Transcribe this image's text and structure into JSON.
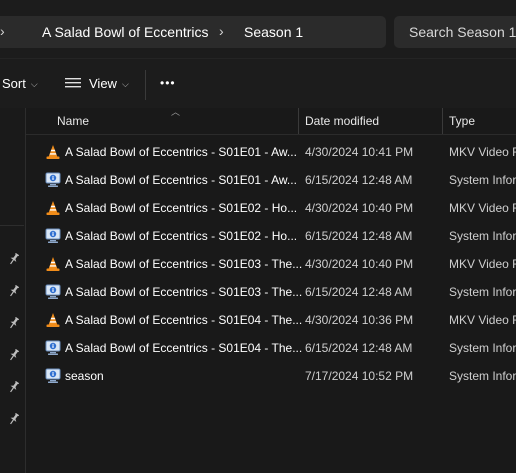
{
  "address_bar": {
    "breadcrumbs": [
      "A Salad Bowl of Eccentrics",
      "Season 1"
    ]
  },
  "search": {
    "placeholder": "Search Season 1"
  },
  "toolbar": {
    "sort_label": "Sort",
    "view_label": "View",
    "more_label": "•••"
  },
  "columns": {
    "name": "Name",
    "date": "Date modified",
    "type": "Type"
  },
  "files": [
    {
      "name": "A Salad Bowl of Eccentrics - S01E01 - Aw...",
      "date": "4/30/2024 10:41 PM",
      "type": "MKV Video F",
      "icon": "vlc-cone-icon"
    },
    {
      "name": "A Salad Bowl of Eccentrics - S01E01 - Aw...",
      "date": "6/15/2024 12:48 AM",
      "type": "System Infor",
      "icon": "system-info-icon"
    },
    {
      "name": "A Salad Bowl of Eccentrics - S01E02 - Ho...",
      "date": "4/30/2024 10:40 PM",
      "type": "MKV Video F",
      "icon": "vlc-cone-icon"
    },
    {
      "name": "A Salad Bowl of Eccentrics - S01E02 - Ho...",
      "date": "6/15/2024 12:48 AM",
      "type": "System Infor",
      "icon": "system-info-icon"
    },
    {
      "name": "A Salad Bowl of Eccentrics - S01E03 - The...",
      "date": "4/30/2024 10:40 PM",
      "type": "MKV Video F",
      "icon": "vlc-cone-icon"
    },
    {
      "name": "A Salad Bowl of Eccentrics - S01E03 - The...",
      "date": "6/15/2024 12:48 AM",
      "type": "System Infor",
      "icon": "system-info-icon"
    },
    {
      "name": "A Salad Bowl of Eccentrics - S01E04 - The...",
      "date": "4/30/2024 10:36 PM",
      "type": "MKV Video F",
      "icon": "vlc-cone-icon"
    },
    {
      "name": "A Salad Bowl of Eccentrics - S01E04 - The...",
      "date": "6/15/2024 12:48 AM",
      "type": "System Infor",
      "icon": "system-info-icon"
    },
    {
      "name": "season",
      "date": "7/17/2024 10:52 PM",
      "type": "System Infor",
      "icon": "system-info-icon"
    }
  ],
  "colors": {
    "background": "#191919",
    "vlc_orange": "#f08c1a",
    "sysinfo_blue": "#4a90e2"
  }
}
